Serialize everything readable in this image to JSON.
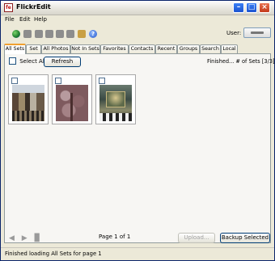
{
  "window": {
    "title": "FlickrEdit",
    "icon_text": "fe",
    "controls": {
      "minimize": "–",
      "maximize": "□",
      "close": "×"
    }
  },
  "menu": {
    "items": [
      "File",
      "Edit",
      "Help"
    ]
  },
  "toolbar": {
    "icons": [
      "globe-icon",
      "arrow-icon",
      "page-icon",
      "rotate-left-icon",
      "rotate-right-icon",
      "tag-icon",
      "folder-icon",
      "help-icon"
    ],
    "help_glyph": "?",
    "user_label": "User:"
  },
  "tabs": [
    "All Sets",
    "Set",
    "All Photos",
    "Not In Sets",
    "Favorites",
    "Contacts",
    "Recent",
    "Groups",
    "Search",
    "Local"
  ],
  "active_tab": "All Sets",
  "panel": {
    "select_all_label": "Select All",
    "refresh_label": "Refresh",
    "status_text": "Finished... # of Sets [3/3]",
    "thumbnails": [
      {
        "kind": "chairs-photo"
      },
      {
        "kind": "tree-photo"
      },
      {
        "kind": "painting-photo"
      }
    ],
    "nav": {
      "prev": "◀",
      "next": "▶",
      "page_icon": "▉"
    },
    "page_label": "Page 1 of 1",
    "upload_label": "Upload...",
    "backup_label": "Backup Selected"
  },
  "statusbar": {
    "text": "Finished loading All Sets for page 1"
  }
}
